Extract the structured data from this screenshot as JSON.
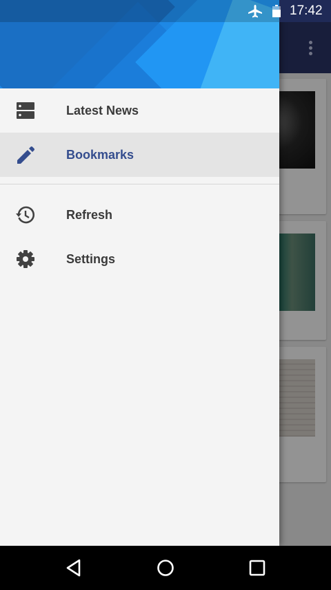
{
  "status_bar": {
    "time": "17:42",
    "airplane_icon": "airplane-icon",
    "battery_icon": "battery-icon"
  },
  "drawer": {
    "items": [
      {
        "label": "Latest News",
        "icon": "news-icon",
        "active": false
      },
      {
        "label": "Bookmarks",
        "icon": "pencil-icon",
        "active": true
      },
      {
        "label": "Refresh",
        "icon": "history-icon",
        "active": false
      },
      {
        "label": "Settings",
        "icon": "gear-icon",
        "active": false
      }
    ]
  },
  "background_app": {
    "overflow_icon": "more-vert-icon"
  },
  "nav_bar": {
    "buttons": [
      "back-icon",
      "home-icon",
      "recents-icon"
    ]
  },
  "colors": {
    "drawer_header": "#1e88e5",
    "active_label": "#344d8e",
    "toolbar": "#2a3566"
  }
}
